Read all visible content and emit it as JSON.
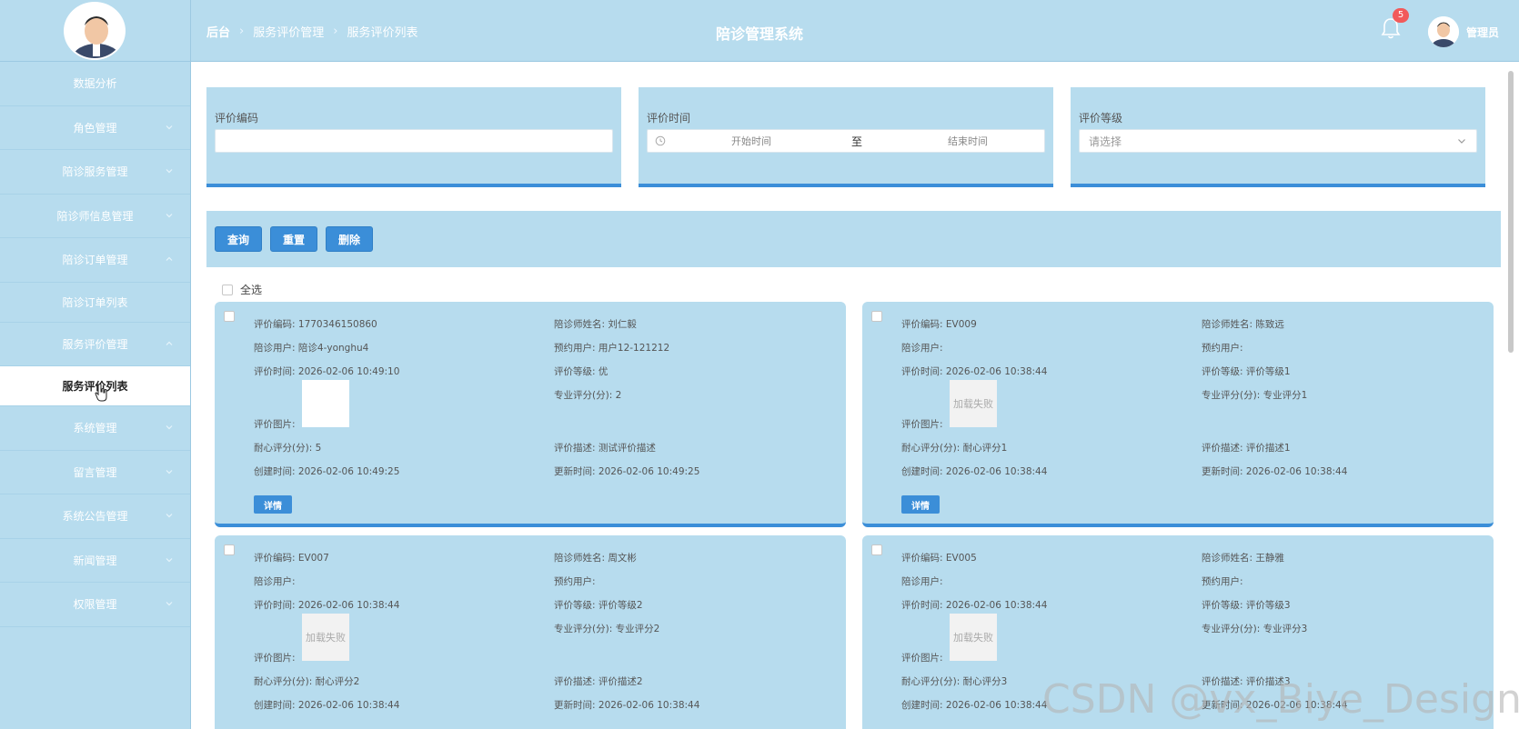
{
  "header": {
    "title": "陪诊管理系统",
    "breadcrumb": [
      "后台",
      "服务评价管理",
      "服务评价列表"
    ],
    "notification_count": "5",
    "user_name": "管理员"
  },
  "sidebar": {
    "items": [
      {
        "label": "数据分析"
      },
      {
        "label": "角色管理"
      },
      {
        "label": "陪诊服务管理"
      },
      {
        "label": "陪诊师信息管理"
      },
      {
        "label": "陪诊订单管理"
      },
      {
        "label": "陪诊订单列表"
      },
      {
        "label": "服务评价管理"
      },
      {
        "label": "服务评价列表"
      },
      {
        "label": "系统管理"
      },
      {
        "label": "留言管理"
      },
      {
        "label": "系统公告管理"
      },
      {
        "label": "新闻管理"
      },
      {
        "label": "权限管理"
      }
    ]
  },
  "filters": {
    "code_label": "评价编码",
    "code_value": "",
    "time_label": "评价时间",
    "start_placeholder": "开始时间",
    "to_text": "至",
    "end_placeholder": "结束时间",
    "level_label": "评价等级",
    "level_placeholder": "请选择"
  },
  "actions": {
    "query": "查询",
    "reset": "重置",
    "delete": "删除",
    "select_all": "全选"
  },
  "labels": {
    "code": "评价编码:",
    "escort_name": "陪诊师姓名:",
    "escort_user": "陪诊用户:",
    "book_user": "预约用户:",
    "time": "评价时间:",
    "level": "评价等级:",
    "professional": "专业评分(分):",
    "image": "评价图片:",
    "patience": "耐心评分(分):",
    "desc": "评价描述:",
    "created": "创建时间:",
    "updated": "更新时间:",
    "detail": "详情",
    "load_failed": "加载失败"
  },
  "cards": [
    {
      "code": "1770346150860",
      "escort_name": "刘仁毅",
      "escort_user": "陪诊4-yonghu4",
      "book_user": "用户12-121212",
      "time": "2026-02-06 10:49:10",
      "level": "优",
      "professional": "2",
      "patience": "5",
      "desc": "测试评价描述",
      "created": "2026-02-06 10:49:25",
      "updated": "2026-02-06 10:49:25"
    },
    {
      "code": "EV009",
      "escort_name": "陈致远",
      "escort_user": "",
      "book_user": "",
      "time": "2026-02-06 10:38:44",
      "level": "评价等级1",
      "professional": "专业评分1",
      "patience": "耐心评分1",
      "desc": "评价描述1",
      "created": "2026-02-06 10:38:44",
      "updated": "2026-02-06 10:38:44"
    },
    {
      "code": "EV007",
      "escort_name": "周文彬",
      "escort_user": "",
      "book_user": "",
      "time": "2026-02-06 10:38:44",
      "level": "评价等级2",
      "professional": "专业评分2",
      "patience": "耐心评分2",
      "desc": "评价描述2",
      "created": "2026-02-06 10:38:44",
      "updated": "2026-02-06 10:38:44"
    },
    {
      "code": "EV005",
      "escort_name": "王静雅",
      "escort_user": "",
      "book_user": "",
      "time": "2026-02-06 10:38:44",
      "level": "评价等级3",
      "professional": "专业评分3",
      "patience": "耐心评分3",
      "desc": "评价描述3",
      "created": "2026-02-06 10:38:44",
      "updated": "2026-02-06 10:38:44"
    }
  ],
  "watermark": "CSDN @vx_Biye_Design",
  "colors": {
    "panel": "#b7dcee",
    "accent": "#3b8ed8",
    "badge": "#f25a5a"
  }
}
